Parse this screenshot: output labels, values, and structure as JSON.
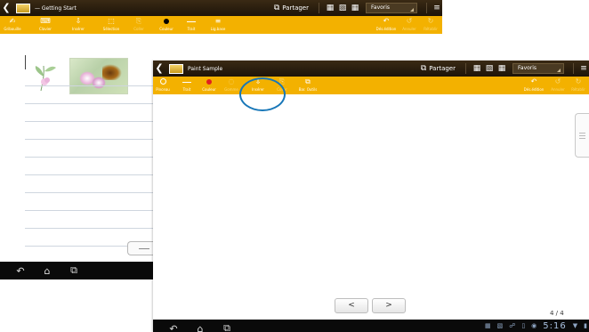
{
  "back_window": {
    "title": "— Getting Start",
    "share_label": "Partager",
    "favorites_label": "Favoris",
    "tools": [
      {
        "icon": "scribble-icon",
        "glyph": "✍",
        "label": "Gribouille"
      },
      {
        "icon": "keyboard-icon",
        "glyph": "⌨",
        "label": "Clavier"
      },
      {
        "icon": "insert-icon",
        "glyph": "⇩",
        "label": "Insérer"
      },
      {
        "icon": "selection-icon",
        "glyph": "⬚",
        "label": "Sélection"
      },
      {
        "icon": "paste-icon",
        "glyph": "⎘",
        "label": "Coller"
      },
      {
        "icon": "color-icon",
        "glyph": "",
        "label": "Couleur"
      },
      {
        "icon": "stroke-icon",
        "glyph": "",
        "label": "Trait"
      },
      {
        "icon": "line-base-icon",
        "glyph": "≡",
        "label": "Lig.base"
      },
      {
        "icon": "undo-edit-icon",
        "glyph": "↶",
        "label": "Dés.édition"
      },
      {
        "icon": "undo-icon",
        "glyph": "↺",
        "label": "Annuler"
      },
      {
        "icon": "redo-icon",
        "glyph": "↻",
        "label": "Rétablir"
      }
    ]
  },
  "front_window": {
    "title": "Paint Sample",
    "share_label": "Partager",
    "favorites_label": "Favoris",
    "tools": [
      {
        "icon": "brush-icon",
        "glyph": "",
        "label": "Pinceau"
      },
      {
        "icon": "stroke-icon",
        "glyph": "",
        "label": "Trait"
      },
      {
        "icon": "color-icon",
        "glyph": "",
        "label": "Couleur"
      },
      {
        "icon": "eraser-icon",
        "glyph": "◌",
        "label": "Gomme"
      },
      {
        "icon": "insert-icon",
        "glyph": "⇩",
        "label": "Insérer"
      },
      {
        "icon": "paste-icon",
        "glyph": "⎘",
        "label": "Coller"
      },
      {
        "icon": "toolbar-icon",
        "glyph": "⧉",
        "label": "Bar. Outils"
      },
      {
        "icon": "undo-edit-icon",
        "glyph": "↶",
        "label": "Dés.édition"
      },
      {
        "icon": "undo-icon",
        "glyph": "↺",
        "label": "Annuler"
      },
      {
        "icon": "redo-icon",
        "glyph": "↻",
        "label": "Rétablir"
      }
    ],
    "prev_label": "<",
    "next_label": ">",
    "page_indicator": "4 / 4"
  },
  "system_bar": {
    "time": "5:16"
  },
  "colors": {
    "toolbar": "#f3b100",
    "titlebar": "#1d1409",
    "highlight": "#1877b8"
  }
}
